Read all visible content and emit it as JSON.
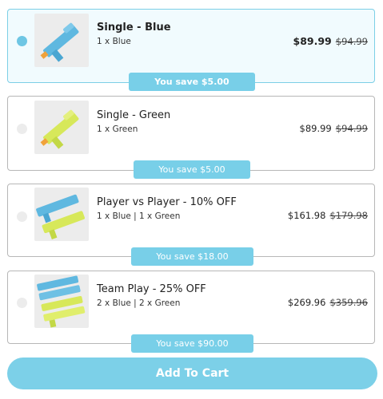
{
  "offers": [
    {
      "title": "Single - Blue",
      "detail": "1 x Blue",
      "price": "$89.99",
      "compare_price": "$94.99",
      "savings": "You save $5.00",
      "selected": true
    },
    {
      "title": "Single - Green",
      "detail": "1 x Green",
      "price": "$89.99",
      "compare_price": "$94.99",
      "savings": "You save $5.00",
      "selected": false
    },
    {
      "title": "Player vs Player - 10% OFF",
      "detail": "1 x Blue | 1 x Green",
      "price": "$161.98",
      "compare_price": "$179.98",
      "savings": "You save $18.00",
      "selected": false
    },
    {
      "title": "Team Play - 25% OFF",
      "detail": "2 x Blue | 2 x Green",
      "price": "$269.96",
      "compare_price": "$359.96",
      "savings": "You save $90.00",
      "selected": false
    }
  ],
  "add_to_cart_label": "Add To Cart",
  "colors": {
    "accent": "#78cfe8",
    "selected_bg": "#f1fbfe",
    "blaster_blue": "#5fb8e0",
    "blaster_green": "#d7e85a"
  },
  "icons": {
    "product": "water-blaster-image"
  }
}
